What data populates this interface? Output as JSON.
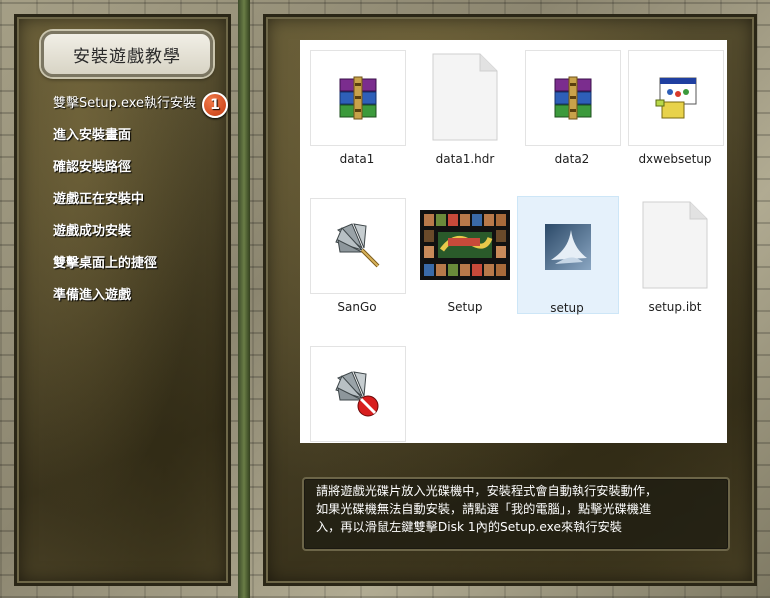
{
  "title": "安裝遊戲教學",
  "steps": {
    "items": [
      "雙擊Setup.exe執行安裝",
      "進入安裝畫面",
      "確認安裝路徑",
      "遊戲正在安裝中",
      "遊戲成功安裝",
      "雙擊桌面上的捷徑",
      "準備進入遊戲"
    ],
    "badge": "1"
  },
  "files": [
    {
      "name": "data1",
      "icon": "winrar-archive-icon"
    },
    {
      "name": "data1.hdr",
      "icon": "blank-document-icon"
    },
    {
      "name": "data2",
      "icon": "winrar-archive-icon"
    },
    {
      "name": "dxwebsetup",
      "icon": "installer-window-icon"
    },
    {
      "name": "SanGo",
      "icon": "feather-fan-icon"
    },
    {
      "name": "Setup",
      "icon": "game-cover-thumbnail"
    },
    {
      "name": "setup",
      "icon": "installshield-icon"
    },
    {
      "name": "setup.ibt",
      "icon": "blank-document-icon"
    },
    {
      "name": "",
      "icon": "feather-fan-blocked-icon"
    }
  ],
  "selected_file": "setup",
  "instruction": "請將遊戲光碟片放入光碟機中，安裝程式會自動執行安裝動作，\n如果光碟機無法自動安裝，請點選「我的電腦」，點擊光碟機進\n入，再以滑鼠左鍵雙擊Disk 1內的Setup.exe來執行安裝",
  "colors": {
    "panel": "#4a4227",
    "badge": "#c63a10",
    "selection": "#e5f1fb"
  }
}
